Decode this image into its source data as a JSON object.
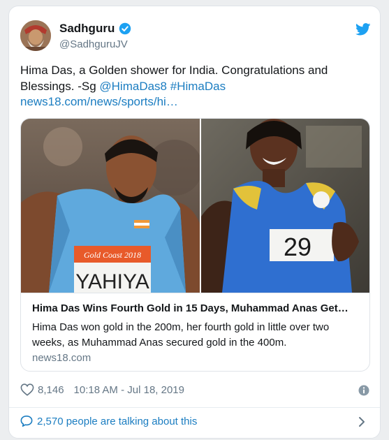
{
  "author": {
    "name": "Sadhguru",
    "handle": "@SadhguruJV"
  },
  "tweet": {
    "text_prefix": "Hima Das, a Golden shower for India.  Congratulations and Blessings. -Sg ",
    "mention": "@HimaDas8",
    "hashtag": "#HimaDas",
    "url": "news18.com/news/sports/hi…"
  },
  "link_card": {
    "left_photo_bib_banner": "Gold Coast 2018",
    "left_photo_bib_name": "YAHIYA",
    "right_photo_bib_number": "29",
    "title": "Hima Das Wins Fourth Gold in 15 Days, Muhammad Anas Get…",
    "description": "Hima Das won gold in the 200m, her fourth gold in little over two weeks, as Muhammad Anas secured gold in the 400m.",
    "domain": "news18.com"
  },
  "meta": {
    "likes": "8,146",
    "timestamp": "10:18 AM - Jul 18, 2019"
  },
  "footer": {
    "talking_text": "2,570 people are talking about this"
  },
  "icons": {
    "verified": "verified-badge-icon",
    "bird": "twitter-bird-icon",
    "heart": "heart-icon",
    "info": "info-icon",
    "bubble": "speech-bubble-icon",
    "chevron": "chevron-right-icon"
  },
  "colors": {
    "link_blue": "#1b7dc1",
    "twitter_blue": "#1da1f2",
    "muted_gray": "#657786"
  }
}
